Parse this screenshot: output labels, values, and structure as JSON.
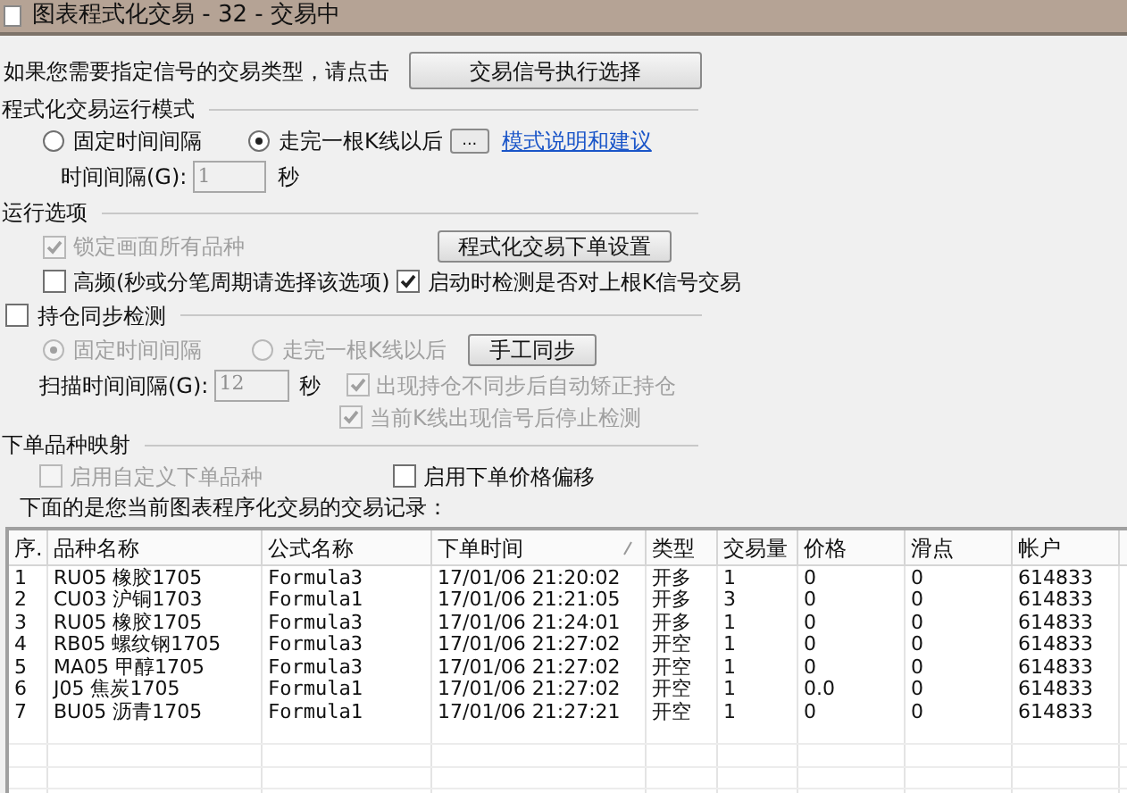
{
  "window": {
    "title": "图表程式化交易 - 32 - 交易中"
  },
  "prompt": {
    "text": "如果您需要指定信号的交易类型，请点击",
    "button": "交易信号执行选择"
  },
  "run_mode": {
    "title": "程式化交易运行模式",
    "options": [
      {
        "label": "固定时间间隔",
        "selected": false,
        "disabled": false
      },
      {
        "label": "走完一根K线以后",
        "selected": true,
        "disabled": false
      }
    ],
    "more_button": "...",
    "help_link": "模式说明和建议",
    "interval_label": "时间间隔(G):",
    "interval_value": "1",
    "interval_disabled": true,
    "unit": "秒"
  },
  "run_options": {
    "title": "运行选项",
    "checkboxes": [
      {
        "label": "锁定画面所有品种",
        "checked": true,
        "disabled": true
      },
      {
        "label": "高频(秒或分笔周期请选择该选项)",
        "checked": false,
        "disabled": false
      },
      {
        "label": "启动时检测是否对上根K信号交易",
        "checked": true,
        "disabled": false
      }
    ],
    "settings_button": "程式化交易下单设置"
  },
  "position_sync": {
    "title": "持仓同步检测",
    "checked": false,
    "options": [
      {
        "label": "固定时间间隔",
        "selected": true,
        "disabled": true
      },
      {
        "label": "走完一根K线以后",
        "selected": false,
        "disabled": true
      }
    ],
    "sync_button": "手工同步",
    "scan_label": "扫描时间间隔(G):",
    "scan_value": "12",
    "scan_disabled": true,
    "unit": "秒",
    "checkboxes": [
      {
        "label": "出现持仓不同步后自动矫正持仓",
        "checked": true,
        "disabled": true
      },
      {
        "label": "当前K线出现信号后停止检测",
        "checked": true,
        "disabled": true
      }
    ]
  },
  "order_mapping": {
    "title": "下单品种映射",
    "checkboxes": [
      {
        "label": "启用自定义下单品种",
        "checked": false,
        "disabled": true
      },
      {
        "label": "启用下单价格偏移",
        "checked": false,
        "disabled": false
      }
    ]
  },
  "records_caption": "下面的是您当前图表程序化交易的交易记录：",
  "table": {
    "columns": [
      "序.",
      "品种名称",
      "公式名称",
      "下单时间",
      "类型",
      "交易量",
      "价格",
      "滑点",
      "帐户"
    ],
    "rows": [
      [
        "1",
        "RU05 橡胶1705",
        "Formula3",
        "17/01/06 21:20:02",
        "开多",
        "1",
        "0",
        "0",
        "614833"
      ],
      [
        "2",
        "CU03 沪铜1703",
        "Formula1",
        "17/01/06 21:21:05",
        "开多",
        "3",
        "0",
        "0",
        "614833"
      ],
      [
        "3",
        "RU05 橡胶1705",
        "Formula3",
        "17/01/06 21:24:01",
        "开多",
        "1",
        "0",
        "0",
        "614833"
      ],
      [
        "4",
        "RB05 螺纹钢1705",
        "Formula3",
        "17/01/06 21:27:02",
        "开空",
        "1",
        "0",
        "0",
        "614833"
      ],
      [
        "5",
        "MA05 甲醇1705",
        "Formula3",
        "17/01/06 21:27:02",
        "开空",
        "1",
        "0",
        "0",
        "614833"
      ],
      [
        "6",
        "J05 焦炭1705",
        "Formula1",
        "17/01/06 21:27:02",
        "开空",
        "1",
        "0.0",
        "0",
        "614833"
      ],
      [
        "7",
        "BU05 沥青1705",
        "Formula1",
        "17/01/06 21:27:21",
        "开空",
        "1",
        "0",
        "0",
        "614833"
      ]
    ]
  }
}
